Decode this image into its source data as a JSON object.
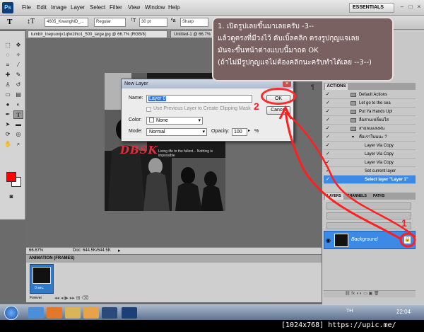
{
  "menu": {
    "logo": "Ps",
    "items": [
      "File",
      "Edit",
      "Image",
      "Layer",
      "Select",
      "Filter",
      "View",
      "Window",
      "Help"
    ],
    "workspace": "ESSENTIALS"
  },
  "options": {
    "font_family": "4605_KwangMD_...",
    "font_style": "Regular",
    "font_size": "30 pt",
    "antialias": "Sharp"
  },
  "tabs": {
    "doc1": "tumblr_lnepuovjv1qfw1tho1_500_large.jpg @ 66.7% (RGB/8)",
    "doc2": "Untitled-1 @ 66.7% (RGB/8)"
  },
  "status": {
    "zoom": "66.67%",
    "doc": "Doc: 644.5K/644.5K"
  },
  "animation": {
    "title": "ANIMATION (FRAMES)",
    "frame_delay": "0 sec.",
    "loop": "Forever"
  },
  "dialog": {
    "title": "New Layer",
    "name_label": "Name:",
    "name_value": "Layer 0",
    "clip_label": "Use Previous Layer to Create Clipping Mask",
    "color_label": "Color:",
    "color_value": "None",
    "mode_label": "Mode:",
    "mode_value": "Normal",
    "opacity_label": "Opacity:",
    "opacity_value": "100",
    "opacity_unit": "%",
    "ok": "OK",
    "cancel": "Cancel"
  },
  "actions_panel": {
    "tab": "ACTIONS",
    "rows": [
      "Default Actions",
      "Let go to the sea",
      "Put Ya Hands Up!",
      "ลือสามเหลี่ยมใส",
      "สายลมแสงฝน",
      "คือเราในนนะ ?",
      "Layer Via Copy",
      "Layer Via Copy",
      "Layer Via Copy",
      "Set current layer",
      "Select layer \"Layer 1\""
    ]
  },
  "layers_panel": {
    "tabs": [
      "LAYERS",
      "CHANNELS",
      "PATHS"
    ],
    "layer_name": "Background"
  },
  "doc_art": {
    "title": "DBSK",
    "caption": "Living life to the fullest... Nothing is impossible"
  },
  "callout": {
    "line1": "1. เปิดรูปเลยขึ้นมาเลยครับ -3--",
    "line2": "แล้วดูตรงที่มีวงไว้ ดับเบิ้ลคลิก ตรงรูปกุญแจเลย",
    "line3": "มันจะขึ้นหน้าต่างแบบนี้มาถด OK",
    "line4": "(ถ้าไม่มีรูปกุญแจไม่ต้องคลิกนะครับทำได้เลย --3--)"
  },
  "markers": {
    "one": "1",
    "two": "2"
  },
  "taskbar": {
    "tray": "TH",
    "clock": "22:04"
  },
  "resolution": "[1024x768] https://upic.me/",
  "colors": {
    "foreground": "#ff0000",
    "background": "#ffffff",
    "annotation": "#ff1f1f",
    "selection": "#3d8ae6"
  }
}
